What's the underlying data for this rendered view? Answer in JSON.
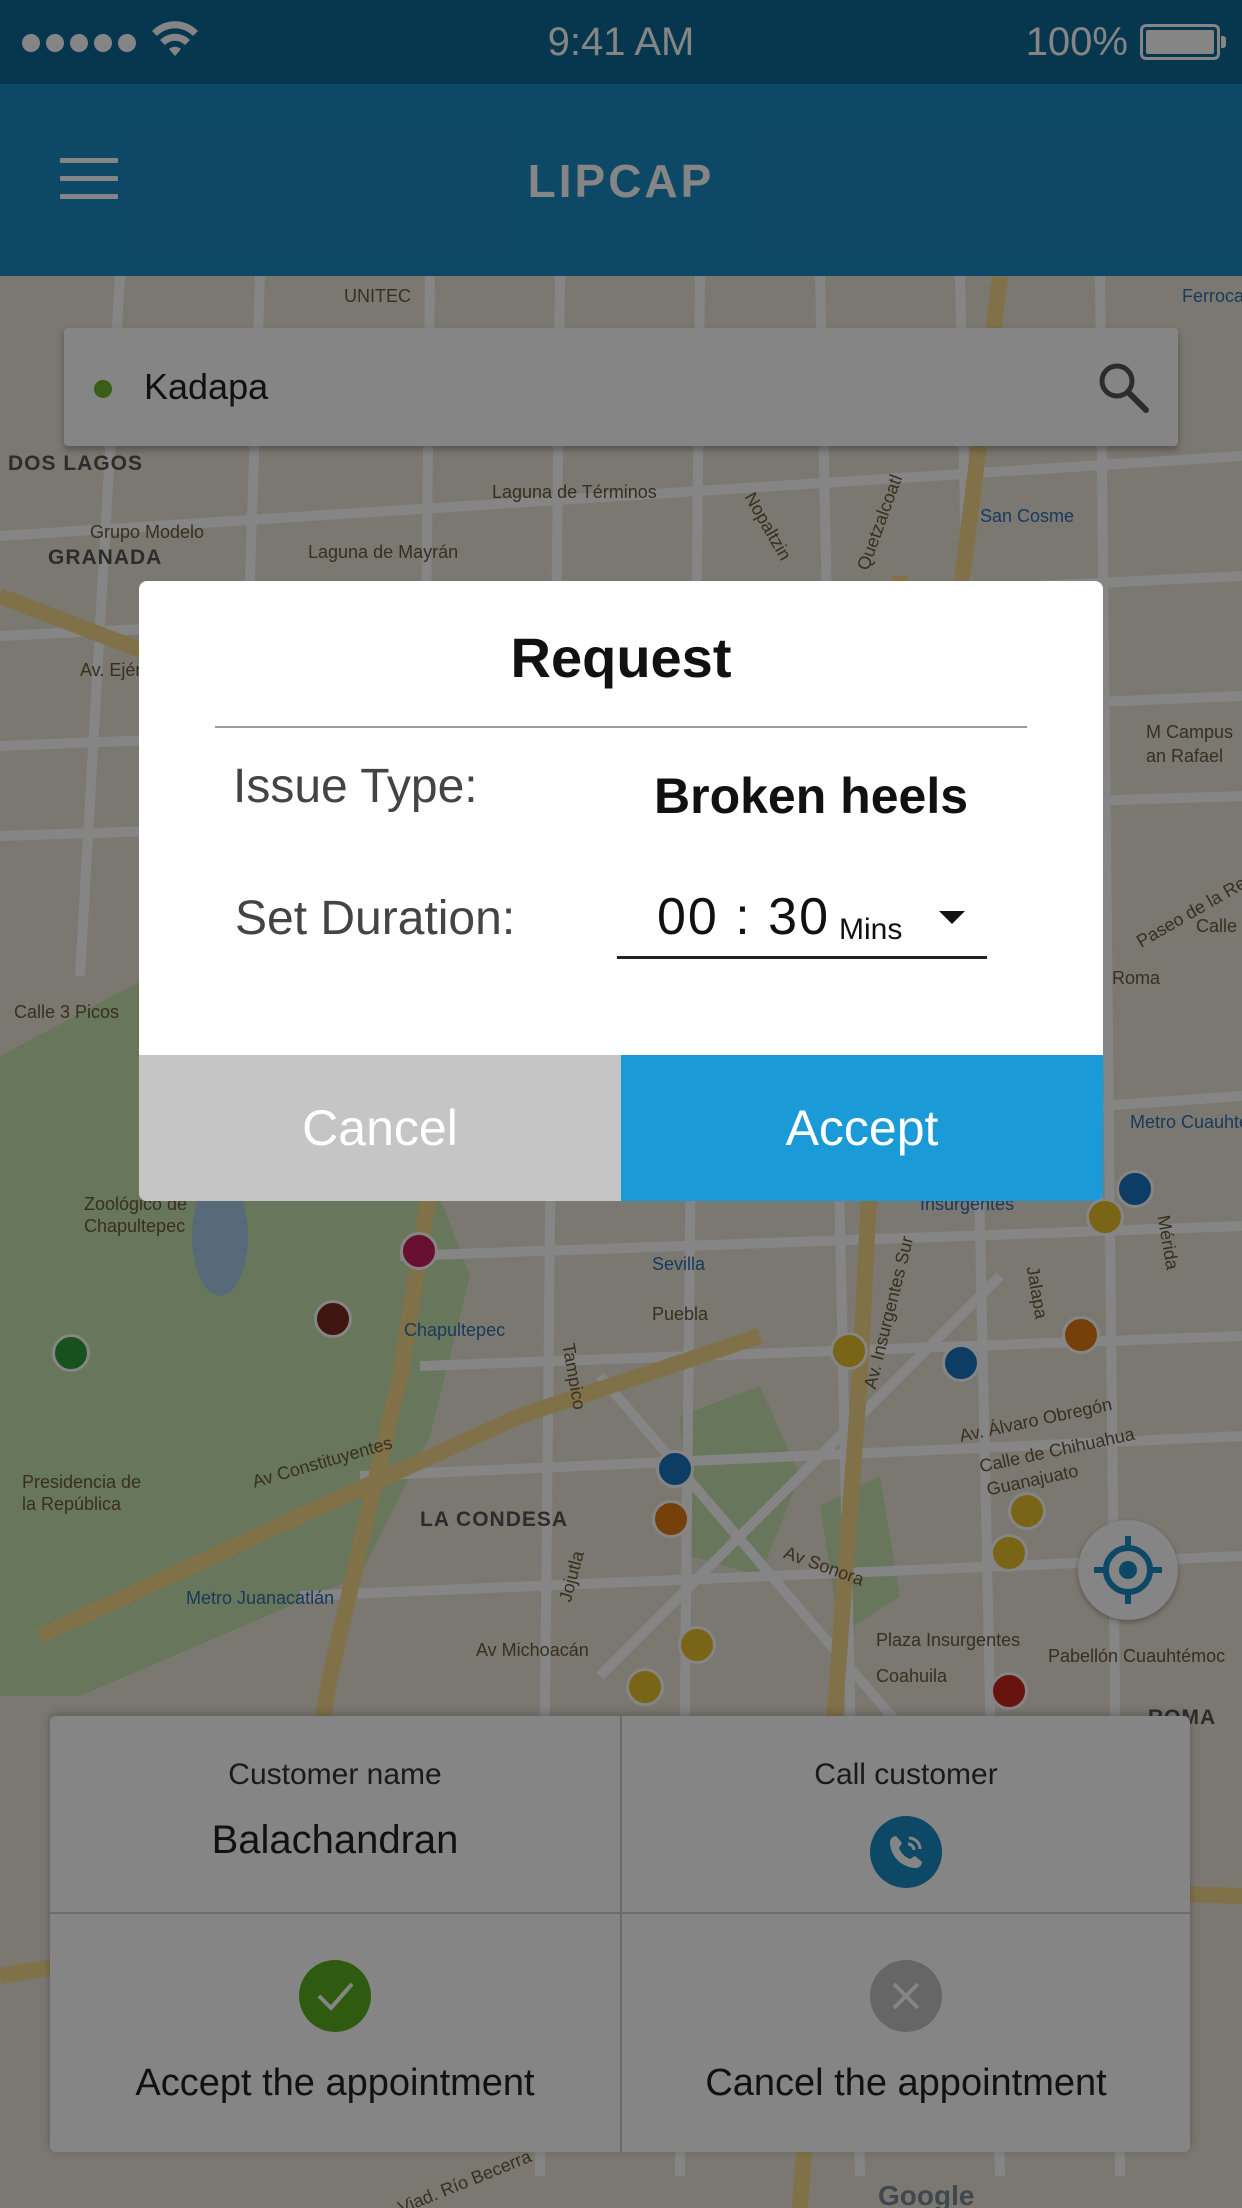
{
  "status_bar": {
    "time": "9:41 AM",
    "battery": "100%"
  },
  "header": {
    "title": "LIPCAP",
    "menu_icon": "hamburger-menu-icon"
  },
  "search": {
    "value": "Kadapa",
    "icon": "search-icon"
  },
  "map": {
    "labels": [
      "DOS LAGOS",
      "Grupo Modelo",
      "GRANADA",
      "Av. Ejército",
      "Laguna de Términos",
      "Laguna de Mayrán",
      "San Cosme",
      "M Campus",
      "an Rafael",
      "Calle 3 Picos",
      "Zoológico de",
      "Chapultepec",
      "Chapultepec",
      "Sevilla",
      "Insurgentes",
      "Presidencia de",
      "la República",
      "Av Constituyentes",
      "LA CONDESA",
      "Metro Juanacatlán",
      "Av Michoacán",
      "Av. Álvaro Obregón",
      "Calle de Chihuahua",
      "Guanajuato",
      "Plaza Insurgentes",
      "Coahuila",
      "Pabellón Cuauhtémoc",
      "ROMA",
      "Av. Insurgentes Sur",
      "Puebla",
      "Jalapa",
      "Mérida",
      "Av Sonora",
      "Roma",
      "Metro Cuauhtémoc",
      "Paseo de la Re",
      "Tampico",
      "Jojutla",
      "Viad. Río Becerra",
      "UNITEC",
      "Ferrocar",
      "Calle",
      "Nopaltzin",
      "Quetzalcoatl"
    ],
    "attribution": "Google",
    "locate_icon": "crosshair-locate-icon"
  },
  "dialog": {
    "title": "Request",
    "issue_label": "Issue Type:",
    "issue_value": "Broken heels",
    "duration_label": "Set Duration:",
    "duration_time": "00 : 30",
    "duration_unit": "Mins",
    "cancel_label": "Cancel",
    "accept_label": "Accept"
  },
  "panel": {
    "customer_label": "Customer name",
    "customer_name": "Balachandran",
    "call_label": "Call customer",
    "accept_action": "Accept the appointment",
    "cancel_action": "Cancel the appointment"
  },
  "colors": {
    "primary": "#1a8ac4",
    "accept_green": "#5aae1f",
    "cancel_grey": "#c5c5c5"
  }
}
